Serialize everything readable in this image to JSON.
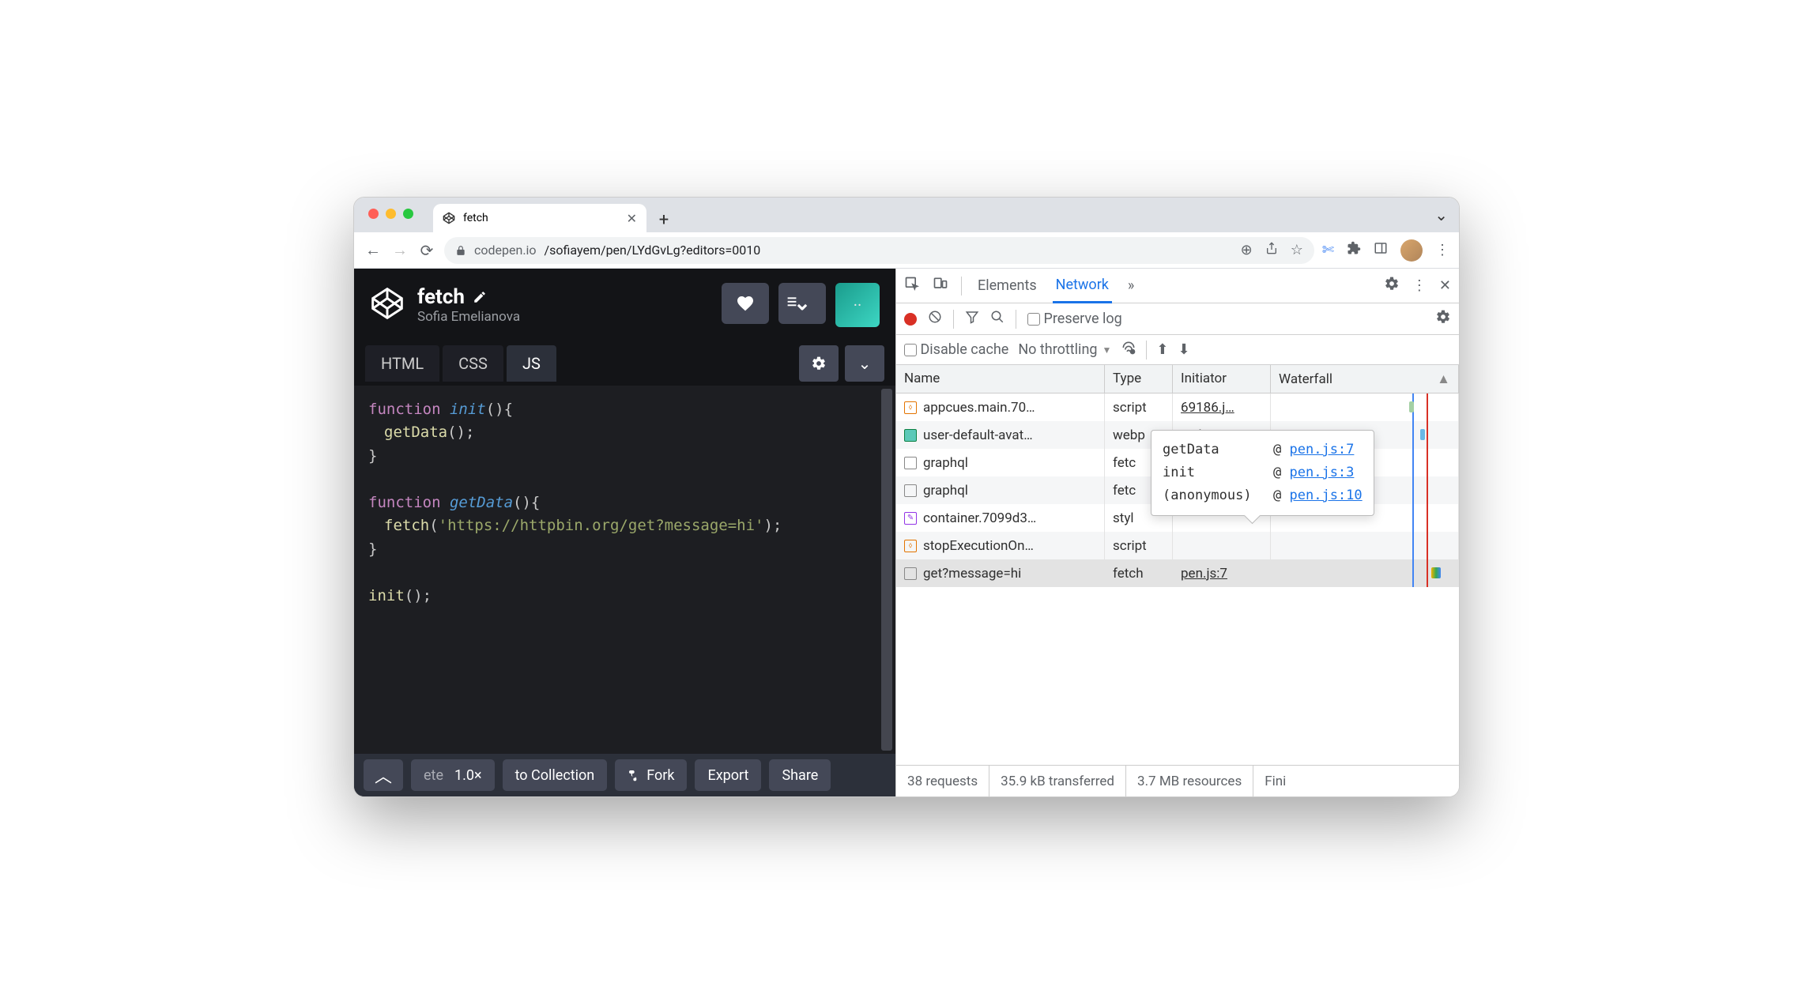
{
  "browser": {
    "tab_title": "fetch",
    "url_host": "codepen.io",
    "url_path": "/sofiayem/pen/LYdGvLg?editors=0010"
  },
  "codepen": {
    "title": "fetch",
    "author": "Sofia Emelianova",
    "tabs": {
      "html": "HTML",
      "css": "CSS",
      "js": "JS"
    },
    "code": {
      "l1a": "function",
      "l1b": "init",
      "l1c": "(){",
      "l2a": "getData",
      "l2b": "();",
      "l3": "}",
      "l5a": "function",
      "l5b": "getData",
      "l5c": "(){",
      "l6a": "fetch",
      "l6b": "(",
      "l6c": "'https://httpbin.org/get?message=hi'",
      "l6d": ");",
      "l7": "}",
      "l9a": "init",
      "l9b": "();"
    },
    "footer": {
      "frag1": "ete",
      "zoom": "1.0×",
      "toCollection": "to Collection",
      "fork": "Fork",
      "export": "Export",
      "share": "Share"
    }
  },
  "devtools": {
    "tabs": {
      "elements": "Elements",
      "network": "Network",
      "more": "»"
    },
    "toolbar": {
      "preserve": "Preserve log",
      "disableCache": "Disable cache",
      "throttling": "No throttling"
    },
    "columns": {
      "name": "Name",
      "type": "Type",
      "initiator": "Initiator",
      "waterfall": "Waterfall"
    },
    "rows": [
      {
        "name": "appcues.main.70…",
        "type": "script",
        "initiator": "69186.j…",
        "icon": "js"
      },
      {
        "name": "user-default-avat…",
        "type": "webp",
        "initiator": "LYdGvL…",
        "icon": "img"
      },
      {
        "name": "graphql",
        "type": "fetc",
        "initiator": "",
        "icon": "empty"
      },
      {
        "name": "graphql",
        "type": "fetc",
        "initiator": "",
        "icon": "empty"
      },
      {
        "name": "container.7099d3…",
        "type": "styl",
        "initiator": "",
        "icon": "css"
      },
      {
        "name": "stopExecutionOn…",
        "type": "script",
        "initiator": "",
        "icon": "js"
      },
      {
        "name": "get?message=hi",
        "type": "fetch",
        "initiator": "pen.js:7",
        "icon": "empty"
      }
    ],
    "tooltip": [
      {
        "fn": "getData",
        "at": "@",
        "loc": "pen.js:7"
      },
      {
        "fn": "init",
        "at": "@",
        "loc": "pen.js:3"
      },
      {
        "fn": "(anonymous)",
        "at": "@",
        "loc": "pen.js:10"
      }
    ],
    "status": {
      "requests": "38 requests",
      "transferred": "35.9 kB transferred",
      "resources": "3.7 MB resources",
      "finish": "Fini"
    }
  }
}
